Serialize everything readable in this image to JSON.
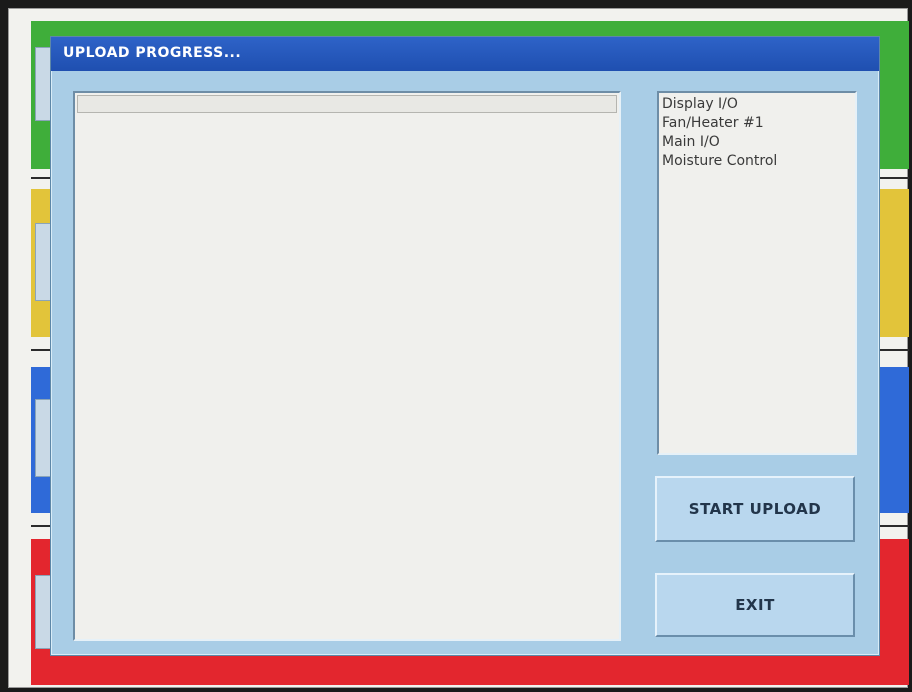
{
  "dialog": {
    "title": "UPLOAD PROGRESS...",
    "progress": 0
  },
  "modules": [
    "Display I/O",
    "Fan/Heater #1",
    "Main I/O",
    "Moisture Control"
  ],
  "buttons": {
    "start_upload": "START UPLOAD",
    "exit": "EXIT"
  },
  "colors": {
    "title_bar": "#2556bd",
    "dialog_bg": "#a9cde6",
    "band_green": "#3fae3a",
    "band_yellow": "#e2c43a",
    "band_blue": "#2f6ad8",
    "band_red": "#e3262e"
  }
}
